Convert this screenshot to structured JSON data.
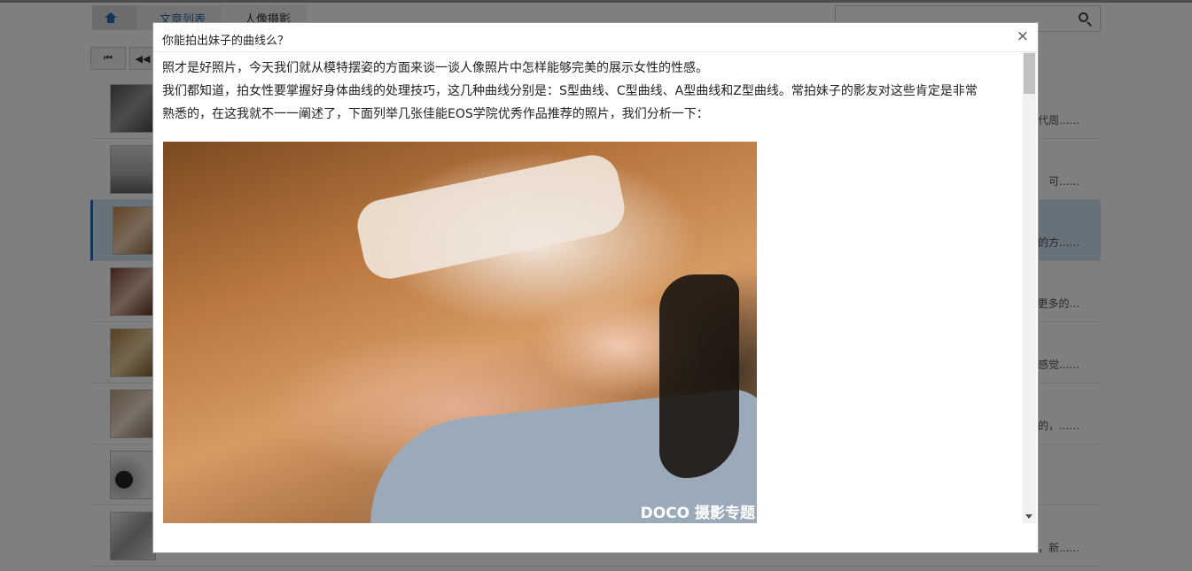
{
  "breadcrumb": {
    "items": [
      "文章列表",
      "人像摄影"
    ]
  },
  "pager": {
    "first_glyph": "⏮",
    "prev_glyph": "◀◀"
  },
  "articles": [
    {
      "excerpt": "代周......"
    },
    {
      "excerpt": "可......"
    },
    {
      "excerpt": "的方......"
    },
    {
      "excerpt": "更多的..."
    },
    {
      "excerpt": "感觉......"
    },
    {
      "excerpt": "的，......"
    },
    {
      "excerpt": ""
    },
    {
      "excerpt": "，新......"
    }
  ],
  "modal": {
    "title": "你能拍出妹子的曲线么？",
    "close_glyph": "×",
    "paragraphs": [
      "照才是好照片，今天我们就从模特摆姿的方面来谈一谈人像照片中怎样能够完美的展示女性的性感。",
      "我们都知道，拍女性要掌握好身体曲线的处理技巧，这几种曲线分别是：S型曲线、C型曲线、A型曲线和Z型曲线。常拍妹子的影友对这些肯定是非常",
      "熟悉的，在这我就不一一阐述了，下面列举几张佳能EOS学院优秀作品推荐的照片，我们分析一下："
    ],
    "photo_watermark": "DOCO 摄影专题"
  },
  "colors": {
    "overlay": "rgba(0,0,0,0.5)",
    "accent": "#2a6db5",
    "active_row": "#cfe2f3"
  }
}
